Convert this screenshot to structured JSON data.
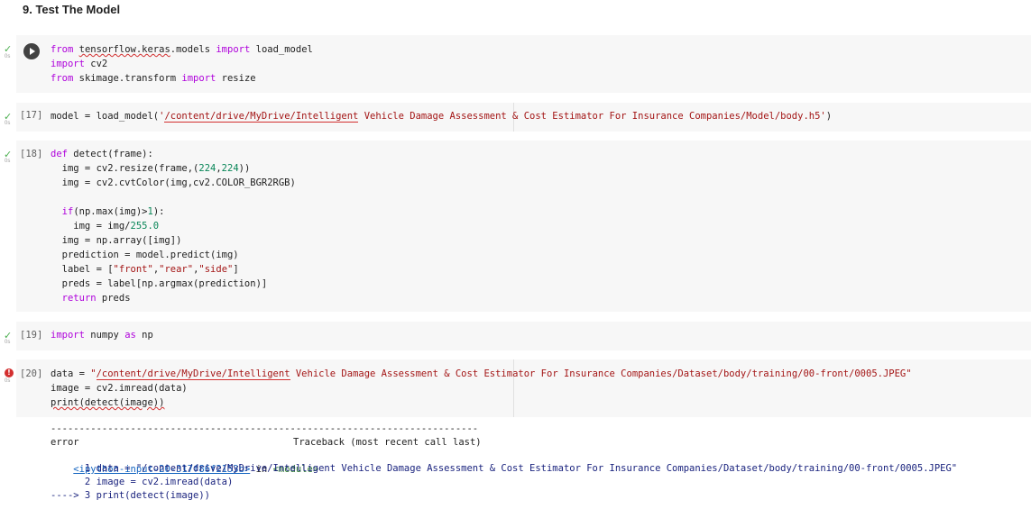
{
  "heading": "9. Test The Model",
  "cells": [
    {
      "status": "✓",
      "duration": "0s",
      "prompt": "",
      "lines": [
        "from tensorflow.keras.models import load_model",
        "import cv2",
        "from skimage.transform import resize"
      ]
    },
    {
      "status": "✓",
      "duration": "0s",
      "prompt": "[17]",
      "lines": [
        "model = load_model('/content/drive/MyDrive/Intelligent Vehicle Damage Assessment & Cost Estimator For Insurance Companies/Model/body.h5')"
      ]
    },
    {
      "status": "✓",
      "duration": "0s",
      "prompt": "[18]",
      "lines": [
        "def detect(frame):",
        "    img = cv2.resize(frame,(224,224))",
        "    img = cv2.cvtColor(img,cv2.COLOR_BGR2RGB)",
        "",
        "    if(np.max(img)>1):",
        "      img = img/255.0",
        "    img = np.array([img])",
        "    prediction = model.predict(img)",
        "    label = [\"front\",\"rear\",\"side\"]",
        "    preds = label[np.argmax(prediction)]",
        "    return preds"
      ]
    },
    {
      "status": "✓",
      "duration": "0s",
      "prompt": "[19]",
      "lines": [
        "import numpy as np"
      ]
    },
    {
      "status": "!",
      "duration": "0s",
      "prompt": "[20]",
      "lines": [
        "data = \"/content/drive/MyDrive/Intelligent Vehicle Damage Assessment & Cost Estimator For Insurance Companies/Dataset/body/training/00-front/0005.JPEG\"",
        "image = cv2.imread(data)",
        "print(detect(image))"
      ]
    }
  ],
  "output": {
    "separator": "---------------------------------------------------------------------------",
    "error_name": "error",
    "traceback_label": "Traceback (most recent call last)",
    "input_ref": "<ipython-input-20-317f86f2153b>",
    "in_word": " in ",
    "module": "<module>",
    "trace_lines": [
      "      1 data = \"/content/drive/MyDrive/Intelligent Vehicle Damage Assessment & Cost Estimator For Insurance Companies/Dataset/body/training/00-front/0005.JPEG\"",
      "      2 image = cv2.imread(data)",
      "----> 3 print(detect(image))"
    ]
  }
}
